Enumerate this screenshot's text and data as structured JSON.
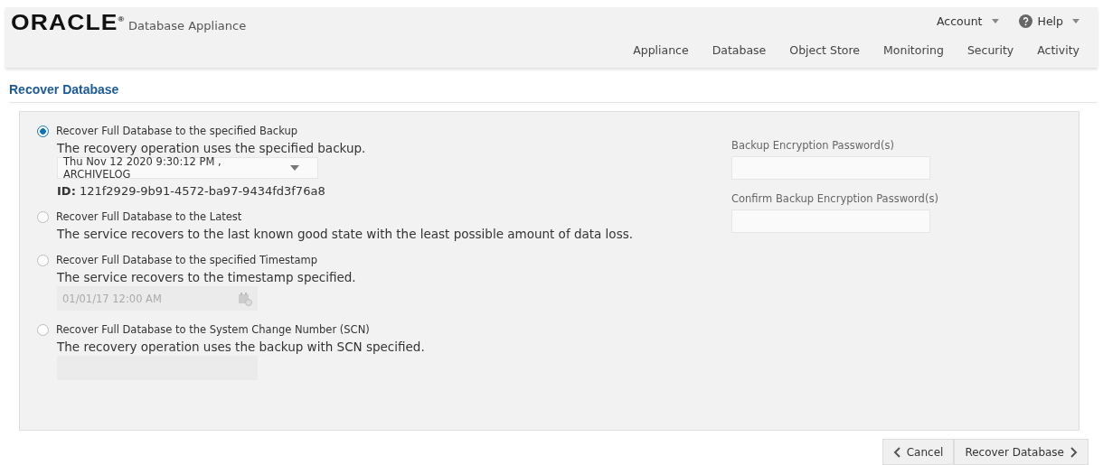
{
  "header": {
    "logo": "ORACLE$^{®}$",
    "product": "Database Appliance",
    "menus": [
      {
        "label": "Account",
        "kind": "plain"
      },
      {
        "label": "Help",
        "kind": "help"
      }
    ],
    "nav": [
      "Appliance",
      "Database",
      "Object Store",
      "Monitoring",
      "Security",
      "Activity"
    ]
  },
  "page_title": "Recover Database",
  "options": [
    {
      "label": "Recover Full Database to the specified Backup",
      "selected": true,
      "description": "The recovery operation uses the specified backup.",
      "kind": "select",
      "value": "Thu Nov 12 2020 9:30:12 PM , ARCHIVELOG",
      "note": "**ID:** 121f2929-9b91-4572-ba97-9434fd3f76a8"
    },
    {
      "label": "Recover Full Database to the Latest",
      "selected": false,
      "description": "The service recovers to the last known good state with the least possible amount of data loss.",
      "kind": "none"
    },
    {
      "label": "Recover Full Database to the specified Timestamp",
      "selected": false,
      "description": "The service recovers to the timestamp specified.",
      "kind": "datetime",
      "placeholder": "01/01/17 12:00 AM"
    },
    {
      "label": "Recover Full Database to the System Change Number (SCN)",
      "selected": false,
      "description": "The recovery operation uses the backup with SCN specified.",
      "kind": "text"
    }
  ],
  "password_fields": [
    {
      "label": "Backup Encryption Password(s)"
    },
    {
      "label": "Confirm Backup Encryption Password(s)"
    }
  ],
  "buttons": [
    {
      "label": "Cancel",
      "kind": "back"
    },
    {
      "label": "Recover Database",
      "kind": "next"
    }
  ]
}
